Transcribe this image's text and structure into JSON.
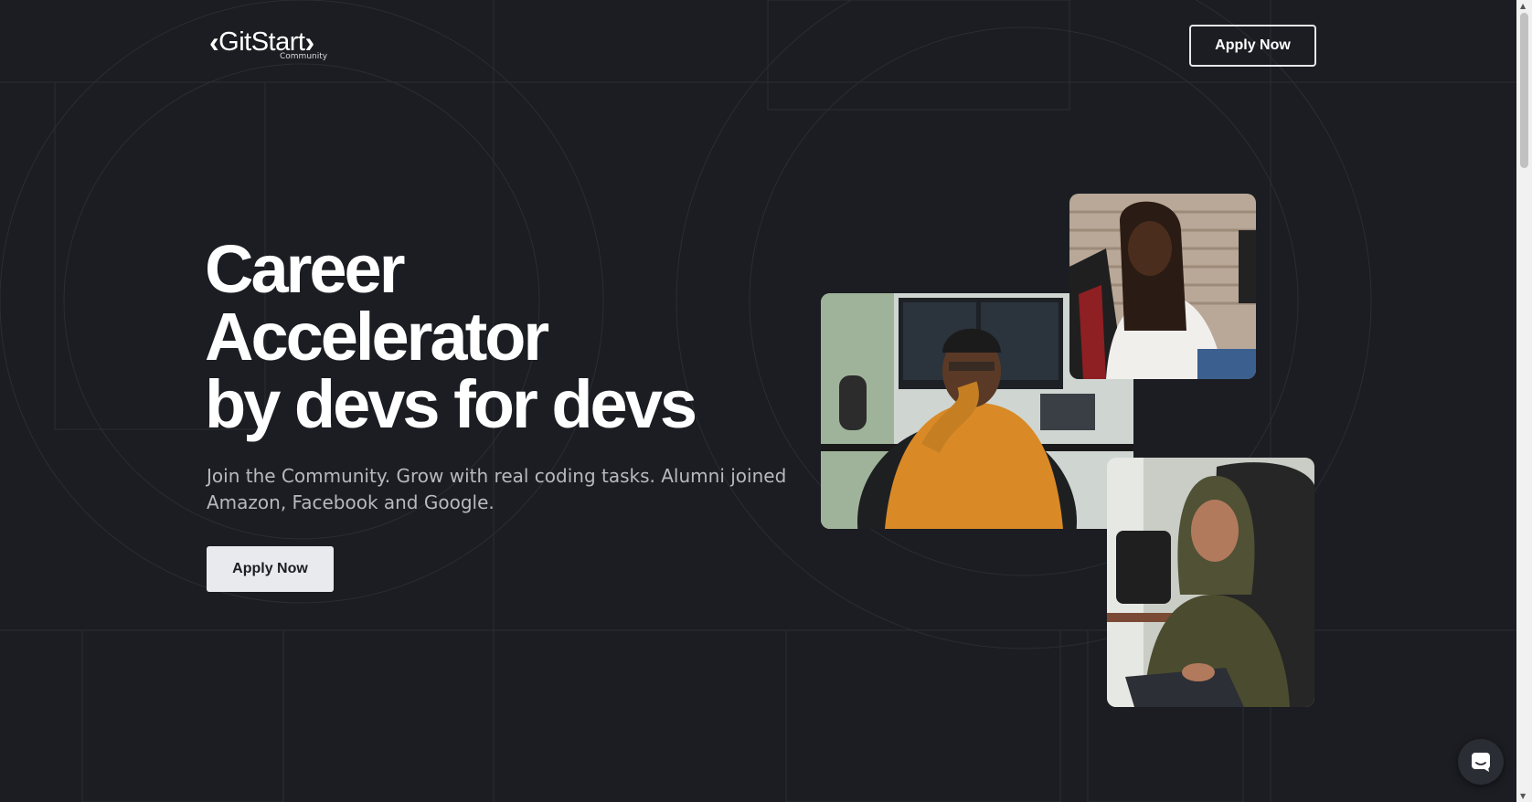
{
  "header": {
    "logo_text": "GitStart",
    "logo_sub": "Community",
    "apply_label": "Apply Now"
  },
  "hero": {
    "headline_line1": "Career",
    "headline_line2": "Accelerator",
    "headline_line3": "by devs for devs",
    "subtext": "Join the Community. Grow with real coding tasks. Alumni joined Amazon, Facebook and Google.",
    "apply_label": "Apply Now"
  },
  "photos": [
    {
      "name": "developer-orange-sweater-photo"
    },
    {
      "name": "developer-white-blouse-photo"
    },
    {
      "name": "developer-hijab-photo"
    }
  ],
  "colors": {
    "background": "#1b1d22",
    "button_light": "#e8eaee",
    "text_muted": "#b7b9bf"
  },
  "icons": {
    "chat": "chat-bubble-icon",
    "logo_left": "chevron-left-icon",
    "logo_right": "chevron-right-icon"
  }
}
